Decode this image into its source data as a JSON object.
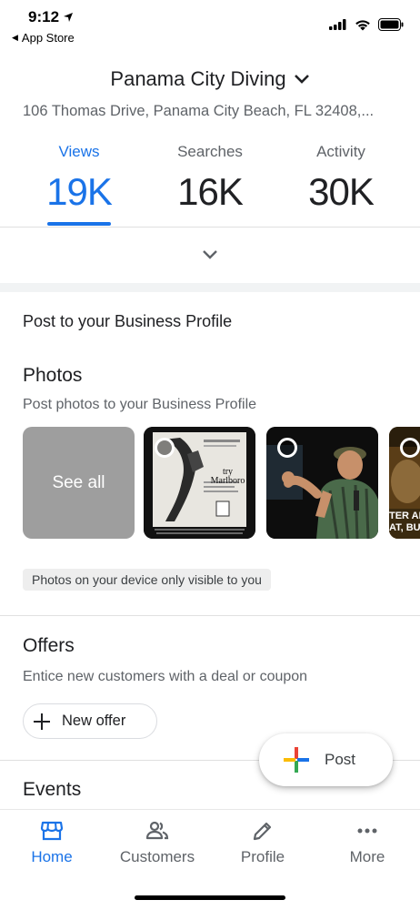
{
  "status_bar": {
    "time": "9:12",
    "back_label": "App Store"
  },
  "business": {
    "name": "Panama City Diving",
    "address": "106 Thomas Drive, Panama City Beach, FL 32408,..."
  },
  "stats": [
    {
      "label": "Views",
      "value": "19K",
      "active": true
    },
    {
      "label": "Searches",
      "value": "16K",
      "active": false
    },
    {
      "label": "Activity",
      "value": "30K",
      "active": false
    }
  ],
  "post_section": {
    "heading": "Post to your Business Profile"
  },
  "photos": {
    "title": "Photos",
    "subtitle": "Post photos to your Business Profile",
    "see_all": "See all",
    "photo_captions": [
      "try Marlboro",
      "",
      "TER AN\nAT, BU"
    ],
    "device_note": "Photos on your device only visible to you"
  },
  "offers": {
    "title": "Offers",
    "subtitle": "Entice new customers with a deal or coupon",
    "new_offer_label": "New offer"
  },
  "events": {
    "title": "Events"
  },
  "fab": {
    "label": "Post"
  },
  "nav": {
    "home": "Home",
    "customers": "Customers",
    "profile": "Profile",
    "more": "More"
  },
  "colors": {
    "accent": "#1a73e8",
    "text": "#202124",
    "secondary": "#5f6368"
  }
}
